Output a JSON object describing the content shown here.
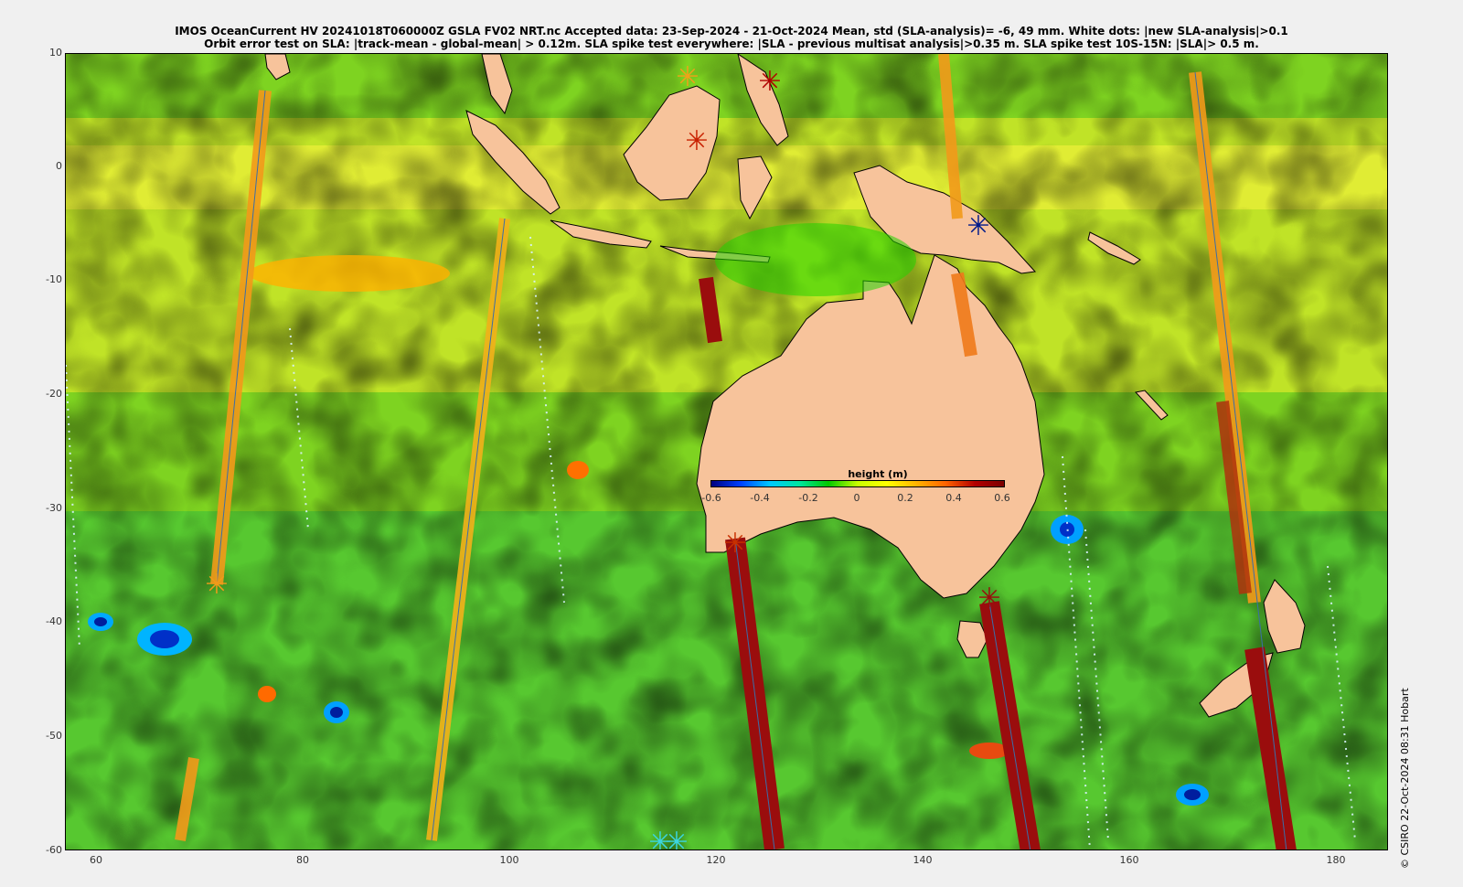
{
  "title": {
    "line1": "IMOS OceanCurrent HV 20241018T060000Z GSLA FV02 NRT.nc  Accepted data: 23-Sep-2024 - 21-Oct-2024 Mean, std (SLA-analysis)= -6, 49 mm. White dots: |new SLA-analysis|>0.1",
    "line2": "Orbit error test on SLA: |track-mean  - global-mean| > 0.12m.  SLA spike test everywhere: |SLA - previous multisat analysis|>0.35 m. SLA spike test 10S-15N: |SLA|> 0.5 m."
  },
  "axes": {
    "x_ticks": [
      "60",
      "80",
      "100",
      "120",
      "140",
      "160",
      "180"
    ],
    "y_ticks": [
      "10",
      "0",
      "-10",
      "-20",
      "-30",
      "-40",
      "-50",
      "-60"
    ],
    "lon_range": [
      57,
      185
    ],
    "lat_range": [
      -60,
      10
    ]
  },
  "colorbar": {
    "title": "height (m)",
    "ticks": [
      "-0.6",
      "-0.4",
      "-0.2",
      "0",
      "0.2",
      "0.4",
      "0.6"
    ],
    "range": [
      -0.6,
      0.6
    ],
    "colormap": [
      "#000080",
      "#0040ff",
      "#00c8ff",
      "#00e6a0",
      "#00c800",
      "#c8ff00",
      "#ffff00",
      "#ffb400",
      "#ff6400",
      "#b40000",
      "#7a0000"
    ]
  },
  "colors": {
    "land": "#f7c39b",
    "ocean_base": "#7ed321",
    "track_orange": "#f29a1a",
    "track_red": "#9a0d0d"
  },
  "credit": "© CSIRO 22-Oct-2024 08:31 Hobart"
}
